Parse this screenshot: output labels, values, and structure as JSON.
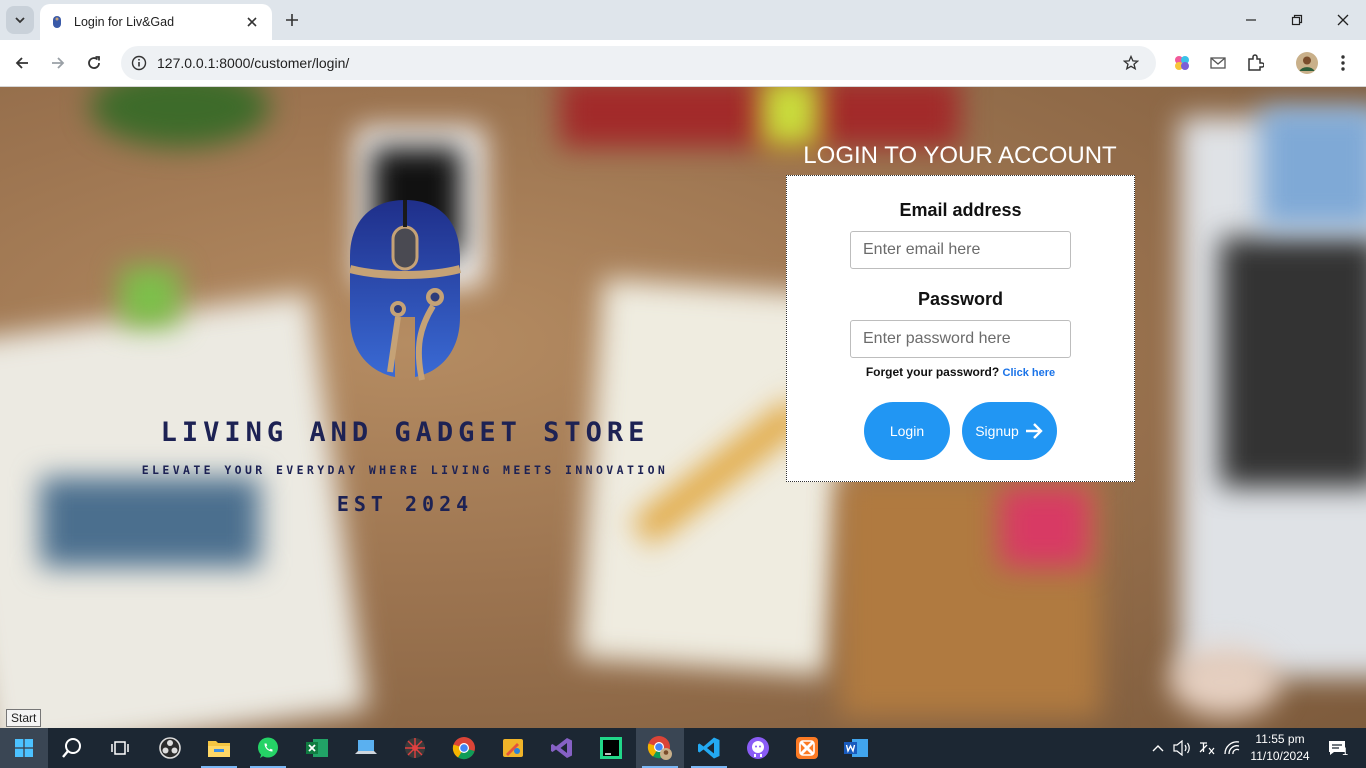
{
  "browser": {
    "tab_title": "Login for Liv&Gad",
    "url": "127.0.0.1:8000/customer/login/"
  },
  "brand": {
    "name": "LIVING AND GADGET STORE",
    "tagline": "ELEVATE YOUR EVERYDAY WHERE LIVING MEETS INNOVATION",
    "established": "EST 2024"
  },
  "login": {
    "heading": "LOGIN TO YOUR ACCOUNT",
    "email_label": "Email address",
    "email_placeholder": "Enter email here",
    "password_label": "Password",
    "password_placeholder": "Enter password here",
    "forgot_text": "Forget your password?",
    "forgot_link": "Click here",
    "login_button": "Login",
    "signup_button": "Signup"
  },
  "tooltip": {
    "start": "Start"
  },
  "taskbar": {
    "time": "11:55 pm",
    "date": "11/10/2024",
    "notification_count": "1"
  },
  "colors": {
    "primary_button": "#2196f3",
    "brand_text": "#1d2254",
    "link": "#1a73e8"
  }
}
